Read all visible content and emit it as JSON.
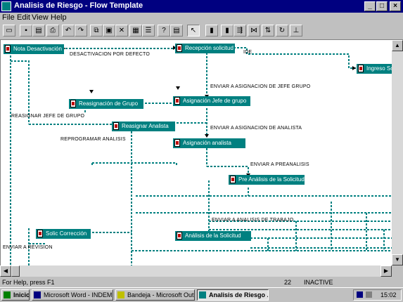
{
  "window": {
    "title": "Analisis de Riesgo - Flow Template",
    "min": "_",
    "max": "□",
    "close": "×"
  },
  "menu": {
    "file": "File",
    "edit": "Edit",
    "view": "View",
    "help": "Help"
  },
  "nodes": {
    "nota_desactivacion": "Nota Desactivación",
    "recepcion_solicitud": "Recepción solicitud",
    "ingreso_sol": "Ingreso So",
    "reasignar_jefe_grupo": "Reasignación de Grupo",
    "asignacion_jefe_grupo": "Asignación Jefe de grupo",
    "reasignar_analista": "Reasignar Analista",
    "asignacion_analista": "Asignación analista",
    "pre_analisis": "Pre Análisis de la Solicitud",
    "solic_correccion": "Solic Corrección",
    "analisis_solicitud": "Análisis de la Solicitud"
  },
  "labels": {
    "desactivacion": "DESACTIVACION POR DEFECTO",
    "ide": "IDE",
    "enviar_asignacion_jefe": "ENVIAR A ASIGNACION DE JEFE GRUPO",
    "reasignar_jefe": "REASIGNAR JEFE DE GRUPO",
    "enviar_asignacion_analista": "ENVIAR A ASIGNACION DE ANALISTA",
    "reprogramar": "REPROGRAMAR ANALISIS",
    "enviar_preanalisis": "ENVIAR A PREANALISIS",
    "enviar_analisis": "ENVIAR A ANALISIS DE TRABAJO",
    "enviar_revision": "ENVIAR A REVISION"
  },
  "status": {
    "text": "For Help, press F1",
    "mode": "INACTIVE",
    "num": "22"
  },
  "taskbar": {
    "start": "Inicio",
    "tasks": [
      "Microsoft Word - INDEM...",
      "Bandeja - Microsoft Outlook",
      "Analisis de Riesgo ..."
    ],
    "clock": "15:02"
  },
  "colors": {
    "node": "#008080",
    "title": "#000080",
    "canvas": "#ffffff"
  }
}
